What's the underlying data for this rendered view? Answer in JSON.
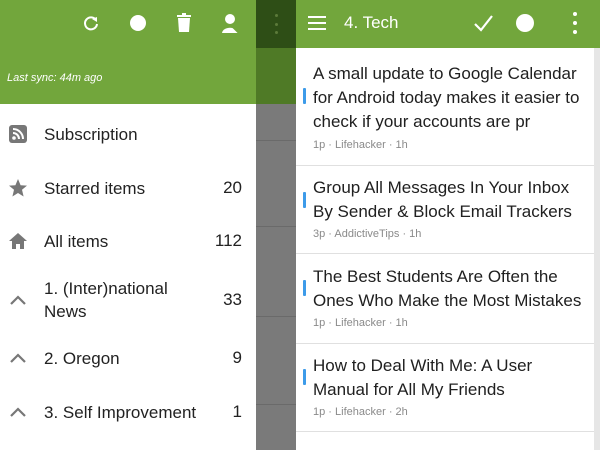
{
  "drawer": {
    "last_sync": "Last sync: 44m ago",
    "toolbar_icons": [
      "refresh-icon",
      "circle-icon",
      "trash-icon",
      "account-icon"
    ],
    "items": [
      {
        "icon": "rss-icon",
        "label": "Subscription",
        "count": ""
      },
      {
        "icon": "star-icon",
        "label": "Starred items",
        "count": "20"
      },
      {
        "icon": "home-icon",
        "label": "All items",
        "count": "112"
      },
      {
        "icon": "chevron-up-icon",
        "label": "1. (Inter)national News",
        "count": "33"
      },
      {
        "icon": "chevron-up-icon",
        "label": "2. Oregon",
        "count": "9"
      },
      {
        "icon": "chevron-up-icon",
        "label": "3. Self Improvement",
        "count": "1"
      }
    ]
  },
  "feed": {
    "title": "4. Tech",
    "toolbar_icons": [
      "menu-icon",
      "check-icon",
      "circle-icon",
      "more-vertical-icon"
    ],
    "accent": "#3d9be9",
    "articles": [
      {
        "headline": "A small update to Google Calendar for Android today makes it easier to check if your accounts are pr",
        "meta": "1p · Lifehacker · 1h"
      },
      {
        "headline": "Group All Messages In Your Inbox By Sender & Block Email Trackers",
        "meta": "3p · AddictiveTips · 1h"
      },
      {
        "headline": "The Best Students Are Often the Ones Who Make the Most Mistakes",
        "meta": "1p · Lifehacker · 1h"
      },
      {
        "headline": "How to Deal With Me: A User Manual for All My Friends",
        "meta": "1p · Lifehacker · 2h"
      }
    ]
  },
  "colors": {
    "toolbar": "#72a63c",
    "scrim": "#7a7a7a"
  }
}
